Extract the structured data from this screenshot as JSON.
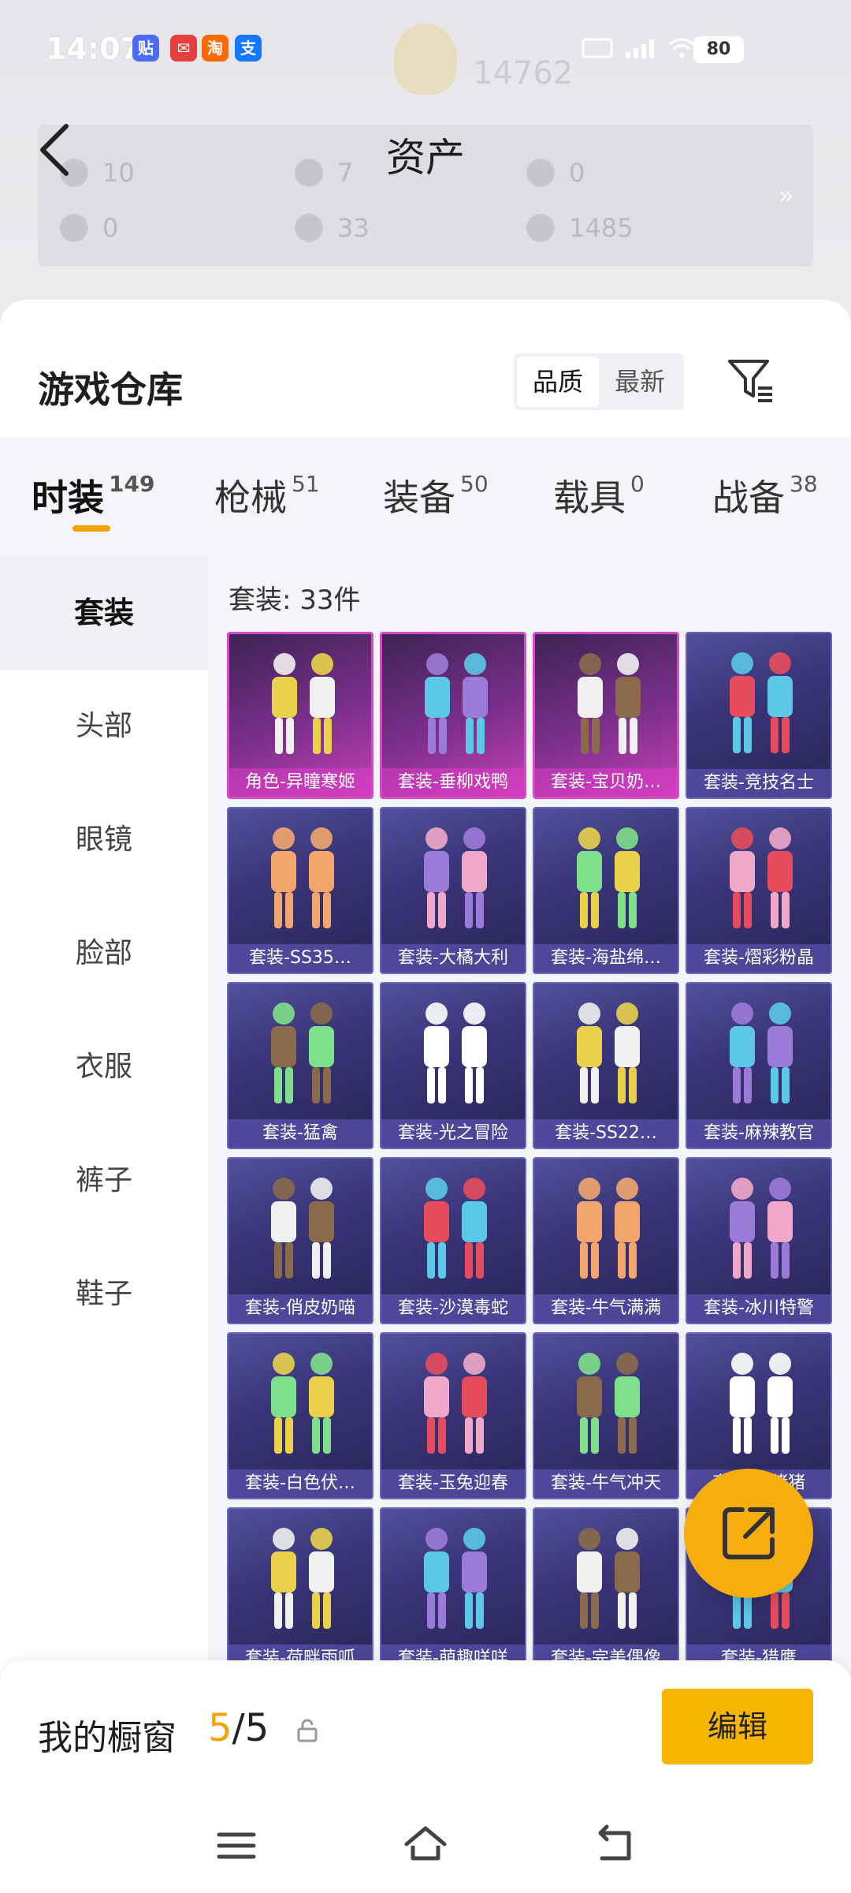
{
  "status_bar": {
    "time": "14:07",
    "app_icons": [
      {
        "name": "tieba-icon",
        "glyph": "贴",
        "color": "#4a6cf7"
      },
      {
        "name": "message-icon",
        "glyph": "",
        "color": "#e44040"
      },
      {
        "name": "taobao-icon",
        "glyph": "淘",
        "color": "#ff6a00"
      },
      {
        "name": "alipay-icon",
        "glyph": "支",
        "color": "#1677ff"
      }
    ],
    "battery": "80"
  },
  "background_header": {
    "rank_number": "14762"
  },
  "assets": {
    "title": "资产",
    "items": [
      {
        "value": "10"
      },
      {
        "value": "7"
      },
      {
        "value": "0"
      },
      {
        "value": "0"
      },
      {
        "value": "33"
      },
      {
        "value": "1485"
      }
    ]
  },
  "warehouse": {
    "title": "游戏仓库",
    "sort_options": [
      "品质",
      "最新"
    ],
    "sort_active": 0
  },
  "tabs": [
    {
      "label": "时装",
      "count": "149",
      "active": true
    },
    {
      "label": "枪械",
      "count": "51"
    },
    {
      "label": "装备",
      "count": "50"
    },
    {
      "label": "载具",
      "count": "0"
    },
    {
      "label": "战备",
      "count": "38"
    }
  ],
  "categories": [
    "套装",
    "头部",
    "眼镜",
    "脸部",
    "衣服",
    "裤子",
    "鞋子"
  ],
  "count_label": "套装: 33件",
  "items": [
    {
      "label": "角色-异瞳寒姬",
      "rarity": "pink"
    },
    {
      "label": "套装-垂柳戏鸭",
      "rarity": "pink"
    },
    {
      "label": "套装-宝贝奶…",
      "rarity": "pink"
    },
    {
      "label": "套装-竞技名士",
      "rarity": "blue"
    },
    {
      "label": "套装-SS35…",
      "rarity": "blue"
    },
    {
      "label": "套装-大橘大利",
      "rarity": "blue"
    },
    {
      "label": "套装-海盐绵…",
      "rarity": "blue"
    },
    {
      "label": "套装-熠彩粉晶",
      "rarity": "blue"
    },
    {
      "label": "套装-猛禽",
      "rarity": "blue"
    },
    {
      "label": "套装-光之冒险",
      "rarity": "blue"
    },
    {
      "label": "套装-SS22…",
      "rarity": "blue"
    },
    {
      "label": "套装-麻辣教官",
      "rarity": "blue"
    },
    {
      "label": "套装-俏皮奶喵",
      "rarity": "blue"
    },
    {
      "label": "套装-沙漠毒蛇",
      "rarity": "blue"
    },
    {
      "label": "套装-牛气满满",
      "rarity": "blue"
    },
    {
      "label": "套装-冰川特警",
      "rarity": "blue"
    },
    {
      "label": "套装-白色伏…",
      "rarity": "blue"
    },
    {
      "label": "套装-玉兔迎春",
      "rarity": "blue"
    },
    {
      "label": "套装-牛气冲天",
      "rarity": "blue"
    },
    {
      "label": "套装-…猪猪",
      "rarity": "blue"
    },
    {
      "label": "套装-荷畔雨呱",
      "rarity": "blue"
    },
    {
      "label": "套装-萌趣咩咩",
      "rarity": "blue"
    },
    {
      "label": "套装-完美偶像",
      "rarity": "blue"
    },
    {
      "label": "套装-猎鹰",
      "rarity": "blue"
    }
  ],
  "showcase": {
    "title": "我的橱窗",
    "current": "5",
    "total": "/5",
    "edit_label": "编辑"
  },
  "colors": {
    "accent": "#f5a300",
    "button": "#f7b500",
    "card_blue": "#3a3579",
    "card_pink": "#c640b4"
  }
}
